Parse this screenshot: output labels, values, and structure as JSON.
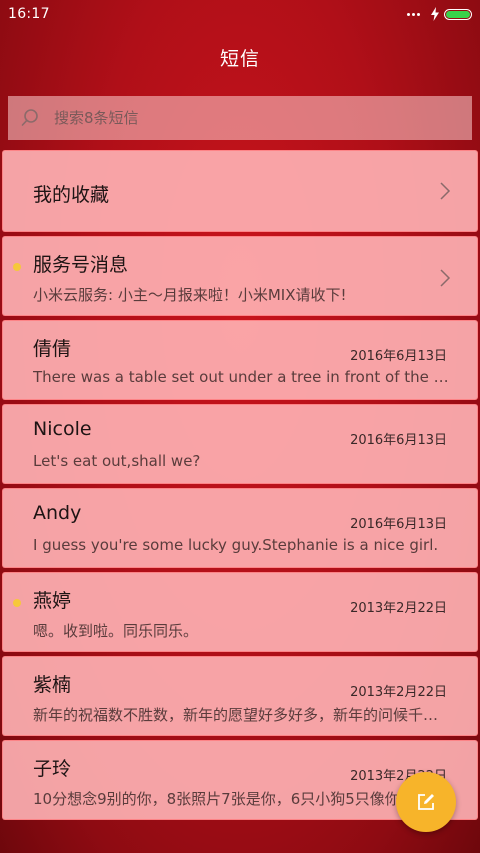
{
  "status_bar": {
    "time": "16:17",
    "battery_level": 1.0,
    "battery_color": "#39d24a"
  },
  "header": {
    "title": "短信"
  },
  "search": {
    "placeholder": "搜索8条短信",
    "icon": "search-icon"
  },
  "favorites": {
    "label": "我的收藏",
    "icon": "chevron-right-icon"
  },
  "service": {
    "title": "服务号消息",
    "snippet": "小米云服务: 小主～月报来啦！小米MIX请收下!",
    "unread": true,
    "icon": "chevron-right-icon"
  },
  "conversations": [
    {
      "name": "倩倩",
      "date": "2016年6月13日",
      "snippet": "There was a table set out under a tree in front of the house",
      "unread": false
    },
    {
      "name": "Nicole",
      "date": "2016年6月13日",
      "snippet": "Let's eat out,shall we?",
      "unread": false
    },
    {
      "name": "Andy",
      "date": "2016年6月13日",
      "snippet": "I guess you're some lucky guy.Stephanie is a nice girl.",
      "unread": false
    },
    {
      "name": "燕婷",
      "date": "2013年2月22日",
      "snippet": "嗯。收到啦。同乐同乐。",
      "unread": true
    },
    {
      "name": "紫楠",
      "date": "2013年2月22日",
      "snippet": "新年的祝福数不胜数，新年的愿望好多好多，新年的问候千言万语",
      "unread": false
    },
    {
      "name": "子玲",
      "date": "2013年2月22日",
      "snippet": "10分想念9别的你，8张照片7张是你，6只小狗5只像你",
      "unread": false
    }
  ],
  "compose": {
    "icon": "compose-icon",
    "color": "#f7b42a"
  },
  "colors": {
    "background": "#b00f18",
    "card": "#ffb4b6",
    "unread_dot": "#f6c83a"
  }
}
